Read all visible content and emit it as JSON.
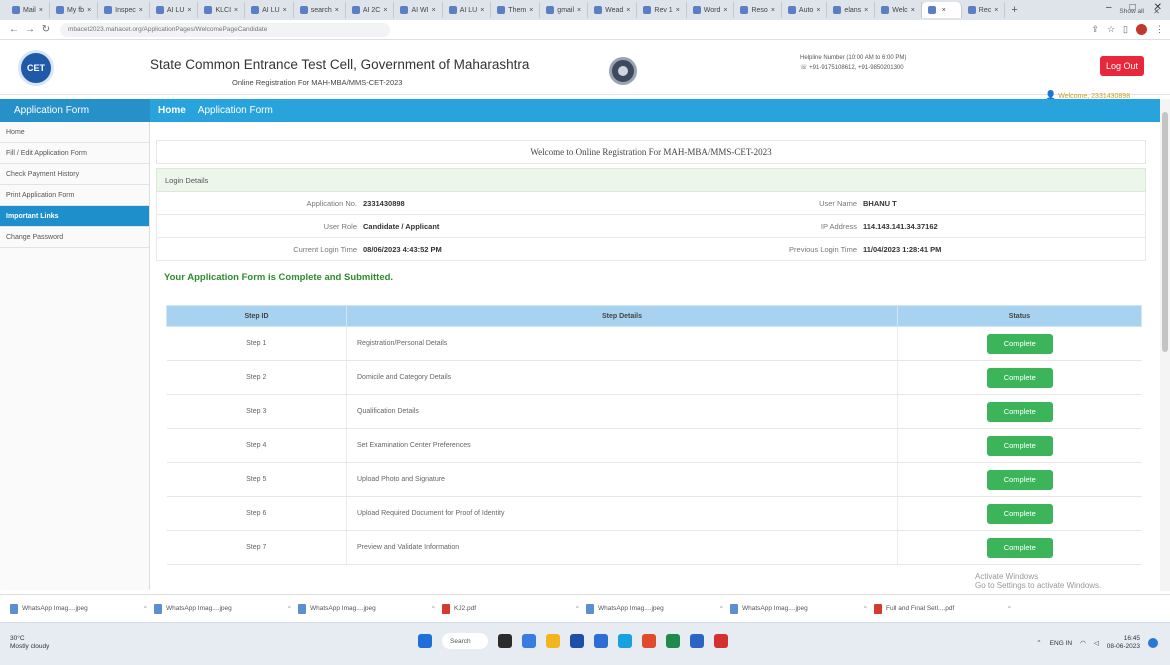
{
  "browser": {
    "tabs": [
      "Mail",
      "My fb",
      "Inspec",
      "AI LU",
      "KLCI",
      "AI LU",
      "search",
      "AI 2C",
      "AI WI",
      "AI LU",
      "Them",
      "gmail",
      "Wead",
      "Rev 1",
      "Word",
      "Reso",
      "Auto",
      "elans",
      "Welc",
      "",
      "Rec"
    ],
    "url": "mbacet2023.mahacet.org/ApplicationPages/WelcomePageCandidate",
    "window_controls": [
      "–",
      "□",
      "✕"
    ]
  },
  "header": {
    "logo_text": "CET",
    "title": "State Common Entrance Test Cell, Government of Maharashtra",
    "subtitle": "Online Registration For MAH-MBA/MMS-CET-2023",
    "helpline_line1": "Helpline Number (10:00 AM to 6:00 PM)",
    "helpline_line2": "+91-9175108612, +91-9850201300",
    "logout_label": "Log Out",
    "welcome_text": "Welcome, 2331430898"
  },
  "navbar": {
    "sidebar_heading": "Application Form",
    "home_label": "Home",
    "app_form_label": "Application Form"
  },
  "sidebar": {
    "items": [
      {
        "label": "Home",
        "active": false
      },
      {
        "label": "Fill / Edit Application Form",
        "active": false
      },
      {
        "label": "Check Payment History",
        "active": false
      },
      {
        "label": "Print Application Form",
        "active": false
      },
      {
        "label": "Important Links",
        "active": true
      },
      {
        "label": "Change Password",
        "active": false
      }
    ]
  },
  "main": {
    "banner": "Welcome to Online Registration For MAH-MBA/MMS-CET-2023",
    "login_heading": "Login Details",
    "login_rows": [
      {
        "label_a": "Application No.",
        "value_a": "2331430898",
        "label_b": "User Name",
        "value_b": "BHANU T"
      },
      {
        "label_a": "User Role",
        "value_a": "Candidate / Applicant",
        "label_b": "IP Address",
        "value_b": "114.143.141.34.37162"
      },
      {
        "label_a": "Current Login Time",
        "value_a": "08/06/2023 4:43:52 PM",
        "label_b": "Previous Login Time",
        "value_b": "11/04/2023 1:28:41 PM"
      }
    ],
    "complete_message": "Your Application Form is Complete and Submitted."
  },
  "steps_table": {
    "headers": [
      "Step ID",
      "Step Details",
      "Status"
    ],
    "rows": [
      {
        "step": "Step 1",
        "details": "Registration/Personal Details",
        "status": "Complete"
      },
      {
        "step": "Step 2",
        "details": "Domicile and Category Details",
        "status": "Complete"
      },
      {
        "step": "Step 3",
        "details": "Qualification Details",
        "status": "Complete"
      },
      {
        "step": "Step 4",
        "details": "Set Examination Center Preferences",
        "status": "Complete"
      },
      {
        "step": "Step 5",
        "details": "Upload Photo and Signature",
        "status": "Complete"
      },
      {
        "step": "Step 6",
        "details": "Upload Required Document for Proof of Identity",
        "status": "Complete"
      },
      {
        "step": "Step 7",
        "details": "Preview and Validate Information",
        "status": "Complete"
      }
    ]
  },
  "watermark": {
    "line1": "Activate Windows",
    "line2": "Go to Settings to activate Windows."
  },
  "downloads": {
    "items": [
      {
        "name": "WhatsApp Imag....jpeg",
        "type": "img"
      },
      {
        "name": "WhatsApp Imag....jpeg",
        "type": "img"
      },
      {
        "name": "WhatsApp Imag....jpeg",
        "type": "img"
      },
      {
        "name": "KJ2.pdf",
        "type": "pdf"
      },
      {
        "name": "WhatsApp Imag....jpeg",
        "type": "img"
      },
      {
        "name": "WhatsApp Imag....jpeg",
        "type": "img"
      },
      {
        "name": "Full and Final Setl....pdf",
        "type": "pdf"
      }
    ],
    "show_all": "Show all"
  },
  "taskbar": {
    "weather_temp": "30°C",
    "weather_desc": "Mostly cloudy",
    "search_label": "Search",
    "lang": "ENG IN",
    "time": "16:45",
    "date": "08-06-2023",
    "app_colors": [
      "#1e6fd9",
      "#2b2b2b",
      "#3a7be0",
      "#f2b51d",
      "#1e4fa8",
      "#2b6fd6",
      "#18a0e0",
      "#e04b2c",
      "#1f8a4c",
      "#2c64c4",
      "#d62f2f"
    ]
  },
  "colors": {
    "nav_blue": "#29a3dc",
    "sidebar_active": "#1f8fcb",
    "complete_green": "#3cb55a",
    "logout_red": "#e8283a",
    "success_text": "#2e8b2e"
  }
}
